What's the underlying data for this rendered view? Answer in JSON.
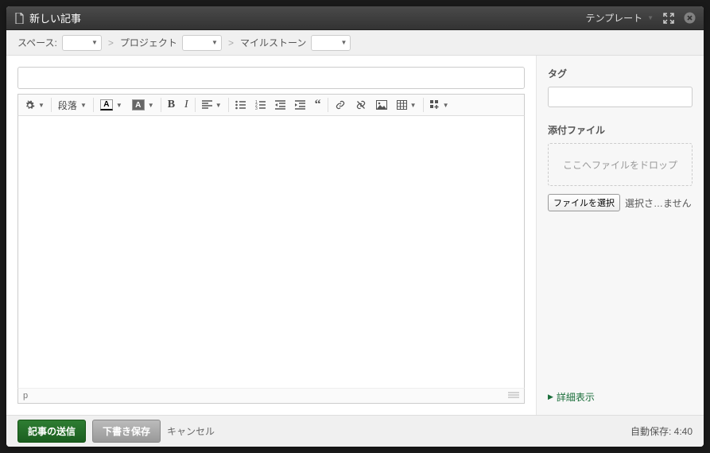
{
  "header": {
    "title": "新しい記事",
    "template_label": "テンプレート"
  },
  "breadcrumb": {
    "space_label": "スペース:",
    "project_label": "プロジェクト",
    "milestone_label": "マイルストーン"
  },
  "toolbar": {
    "format_label": "段落"
  },
  "statusbar": {
    "path": "p"
  },
  "sidebar": {
    "tags_label": "タグ",
    "attachments_label": "添付ファイル",
    "dropzone_text": "ここへファイルをドロップ",
    "choose_file_label": "ファイルを選択",
    "file_status": "選択さ…ません",
    "detail_label": "詳細表示"
  },
  "footer": {
    "submit_label": "記事の送信",
    "draft_label": "下書き保存",
    "cancel_label": "キャンセル",
    "autosave_label": "自動保存:",
    "autosave_time": "4:40"
  }
}
